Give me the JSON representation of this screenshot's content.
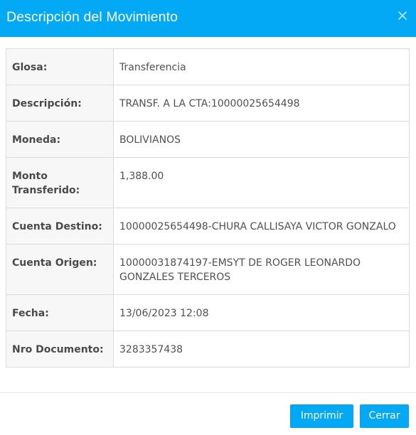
{
  "modal": {
    "title": "Descripción del Movimiento",
    "close_icon": "close-icon",
    "accent_color": "#03a9f4"
  },
  "details": [
    {
      "label": "Glosa:",
      "value": "Transferencia"
    },
    {
      "label": "Descripción:",
      "value": "TRANSF. A LA CTA:10000025654498"
    },
    {
      "label": "Moneda:",
      "value": "BOLIVIANOS"
    },
    {
      "label": "Monto Transferido:",
      "value": "1,388.00"
    },
    {
      "label": "Cuenta Destino:",
      "value": "10000025654498-CHURA CALLISAYA VICTOR GONZALO"
    },
    {
      "label": "Cuenta Origen:",
      "value": "10000031874197-EMSYT DE ROGER LEONARDO GONZALES TERCEROS"
    },
    {
      "label": "Fecha:",
      "value": "13/06/2023 12:08"
    },
    {
      "label": "Nro Documento:",
      "value": "3283357438"
    }
  ],
  "footer": {
    "print_label": "Imprimir",
    "close_label": "Cerrar"
  }
}
